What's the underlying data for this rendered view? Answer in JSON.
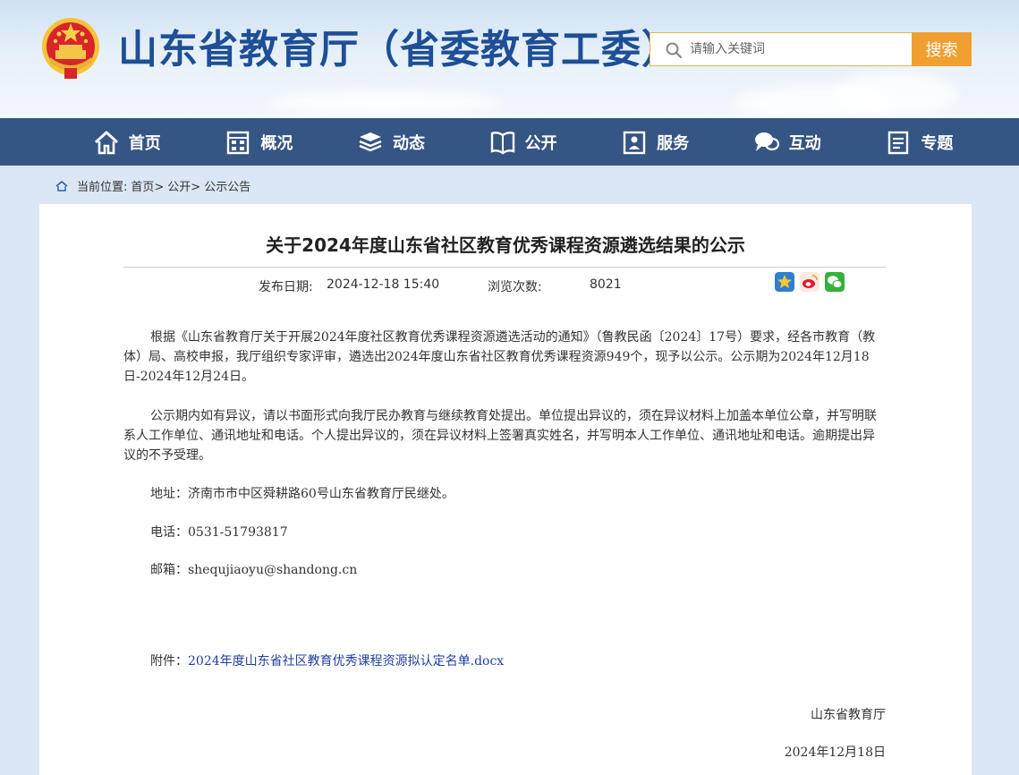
{
  "header": {
    "site_title": "山东省教育厅（省委教育工委）",
    "search_placeholder": "请输入关键词",
    "search_button": "搜索"
  },
  "nav": [
    {
      "label": "首页",
      "icon": "home-icon"
    },
    {
      "label": "概况",
      "icon": "building-icon"
    },
    {
      "label": "动态",
      "icon": "news-icon"
    },
    {
      "label": "公开",
      "icon": "book-icon"
    },
    {
      "label": "服务",
      "icon": "service-icon"
    },
    {
      "label": "互动",
      "icon": "chat-icon"
    },
    {
      "label": "专题",
      "icon": "topic-icon"
    }
  ],
  "breadcrumb": {
    "prefix": "当前位置:",
    "items": [
      "首页>",
      "公开>",
      "公示公告"
    ]
  },
  "article": {
    "title": "关于2024年度山东省社区教育优秀课程资源遴选结果的公示",
    "date_label": "发布日期:",
    "date_value": "2024-12-18 15:40",
    "views_label": "浏览次数:",
    "views_value": "8021",
    "paragraph1": "根据《山东省教育厅关于开展2024年度社区教育优秀课程资源遴选活动的通知》（鲁教民函〔2024〕17号）要求，经各市教育（教体）局、高校申报，我厅组织专家评审，遴选出2024年度山东省社区教育优秀课程资源949个，现予以公示。公示期为2024年12月18日-2024年12月24日。",
    "paragraph2": "公示期内如有异议，请以书面形式向我厅民办教育与继续教育处提出。单位提出异议的，须在异议材料上加盖本单位公章，并写明联系人工作单位、通讯地址和电话。个人提出异议的，须在异议材料上签署真实姓名，并写明本人工作单位、通讯地址和电话。逾期提出异议的不予受理。",
    "address": "地址：济南市市中区舜耕路60号山东省教育厅民继处。",
    "phone": "电话：0531-51793817",
    "email": "邮箱：shequjiaoyu@shandong.cn",
    "attachment_label": "附件：",
    "attachment_link": "2024年度山东省社区教育优秀课程资源拟认定名单.docx",
    "signature_org": "山东省教育厅",
    "signature_date": "2024年12月18日"
  },
  "colors": {
    "nav_bg": "#355584",
    "title_blue": "#1e4f96",
    "search_button": "#f0a030"
  }
}
